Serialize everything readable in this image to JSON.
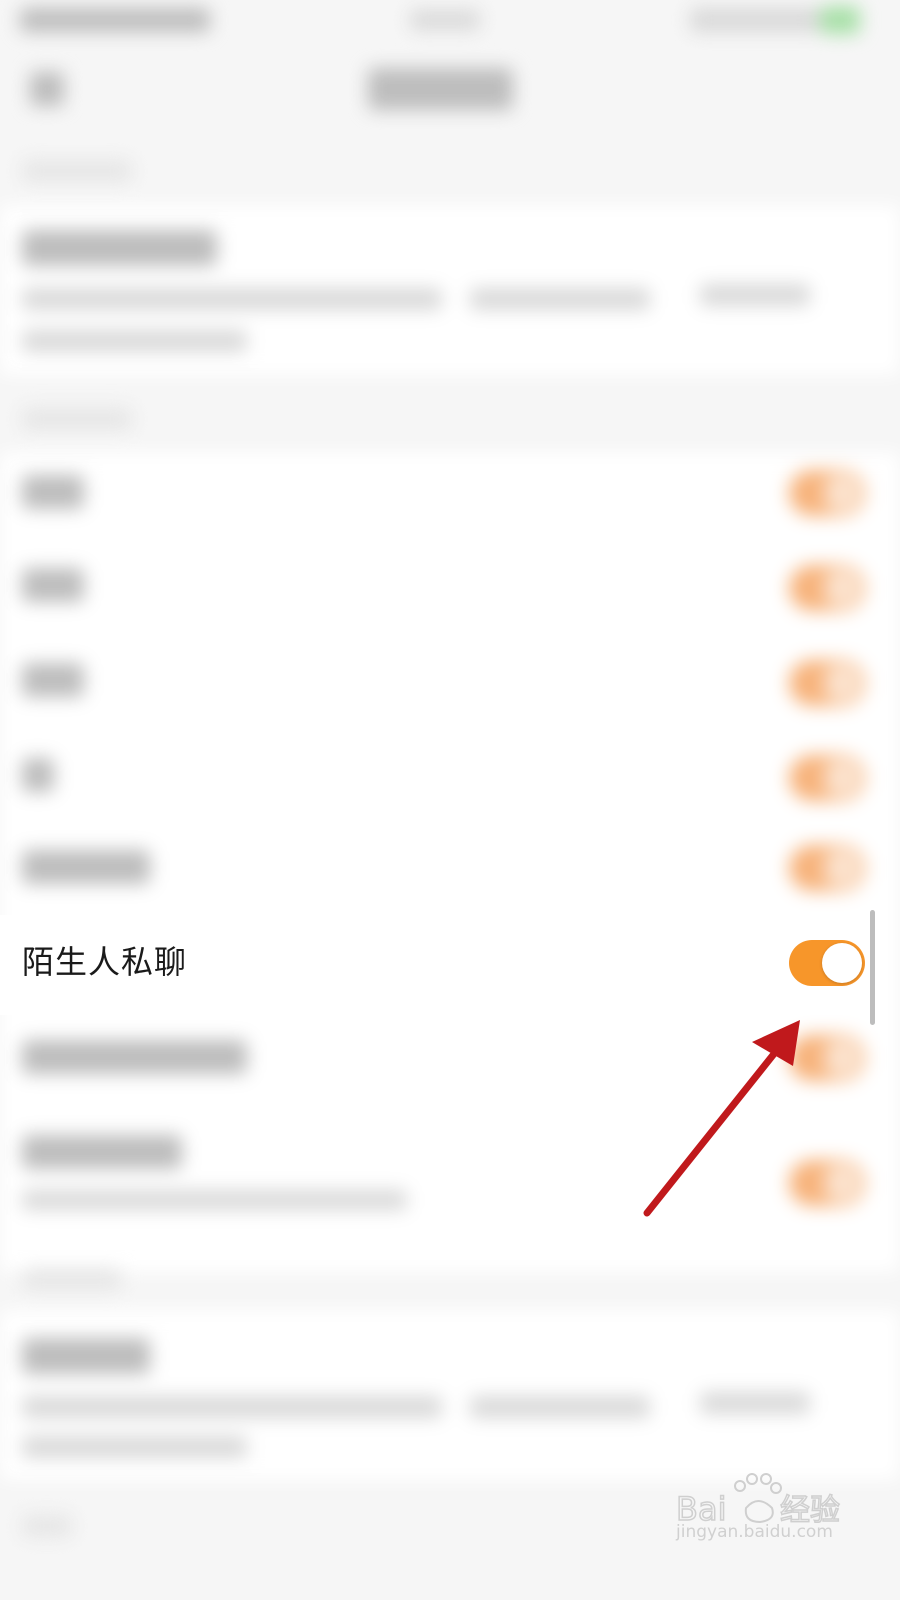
{
  "settings": {
    "stranger_private_chat": {
      "label": "陌生人私聊",
      "enabled": true
    }
  },
  "colors": {
    "toggle_on": "#f7962a",
    "annotation_arrow": "#c0191c"
  },
  "watermark": {
    "logo": "Bai du 经验",
    "url": "jingyan.baidu.com"
  }
}
